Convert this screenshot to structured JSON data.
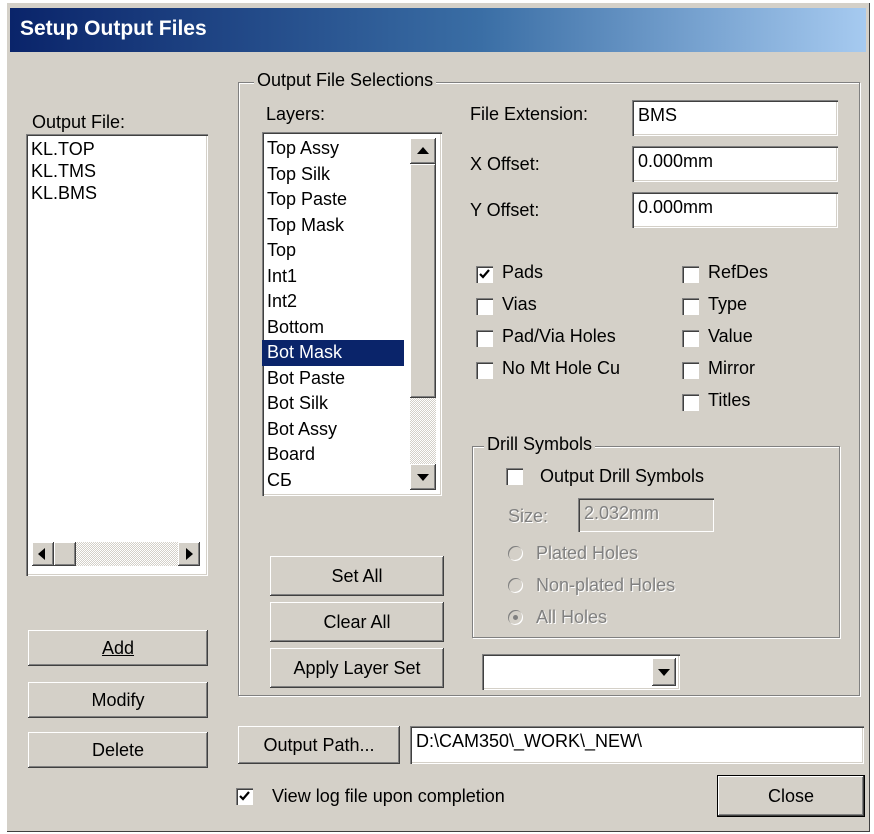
{
  "window": {
    "title": "Setup Output Files"
  },
  "output_file": {
    "label": "Output File:",
    "items": [
      "KL.TOP",
      "KL.TMS",
      "KL.BMS"
    ]
  },
  "buttons": {
    "add": "Add",
    "modify": "Modify",
    "delete": "Delete",
    "set_all": "Set All",
    "clear_all": "Clear All",
    "apply_layer_set": "Apply Layer Set",
    "output_path": "Output Path...",
    "close": "Close"
  },
  "selections": {
    "group_title": "Output File Selections",
    "layers_label": "Layers:",
    "layers": [
      "Top Assy",
      "Top Silk",
      "Top Paste",
      "Top Mask",
      "Top",
      "Int1",
      "Int2",
      "Bottom",
      "Bot Mask",
      "Bot Paste",
      "Bot Silk",
      "Bot Assy",
      "Board",
      "CБ"
    ],
    "selected_layer": "Bot Mask"
  },
  "fields": {
    "file_extension_label": "File Extension:",
    "file_extension_value": "BMS",
    "x_offset_label": "X Offset:",
    "x_offset_value": "0.000mm",
    "y_offset_label": "Y Offset:",
    "y_offset_value": "0.000mm"
  },
  "checkboxes_left": [
    {
      "label": "Pads",
      "checked": true
    },
    {
      "label": "Vias",
      "checked": false
    },
    {
      "label": "Pad/Via Holes",
      "checked": false
    },
    {
      "label": "No Mt Hole Cu",
      "checked": false
    }
  ],
  "checkboxes_right": [
    {
      "label": "RefDes",
      "checked": false
    },
    {
      "label": "Type",
      "checked": false
    },
    {
      "label": "Value",
      "checked": false
    },
    {
      "label": "Mirror",
      "checked": false
    },
    {
      "label": "Titles",
      "checked": false
    }
  ],
  "drill": {
    "group_title": "Drill Symbols",
    "output_label": "Output Drill Symbols",
    "output_checked": false,
    "size_label": "Size:",
    "size_value": "2.032mm",
    "radios": [
      {
        "label": "Plated Holes",
        "selected": false
      },
      {
        "label": "Non-plated Holes",
        "selected": false
      },
      {
        "label": "All Holes",
        "selected": true
      }
    ]
  },
  "layer_set_dropdown": {
    "value": ""
  },
  "output_path": {
    "value": "D:\\CAM350\\_WORK\\_NEW\\"
  },
  "view_log": {
    "label": "View log file upon completion",
    "checked": true
  }
}
